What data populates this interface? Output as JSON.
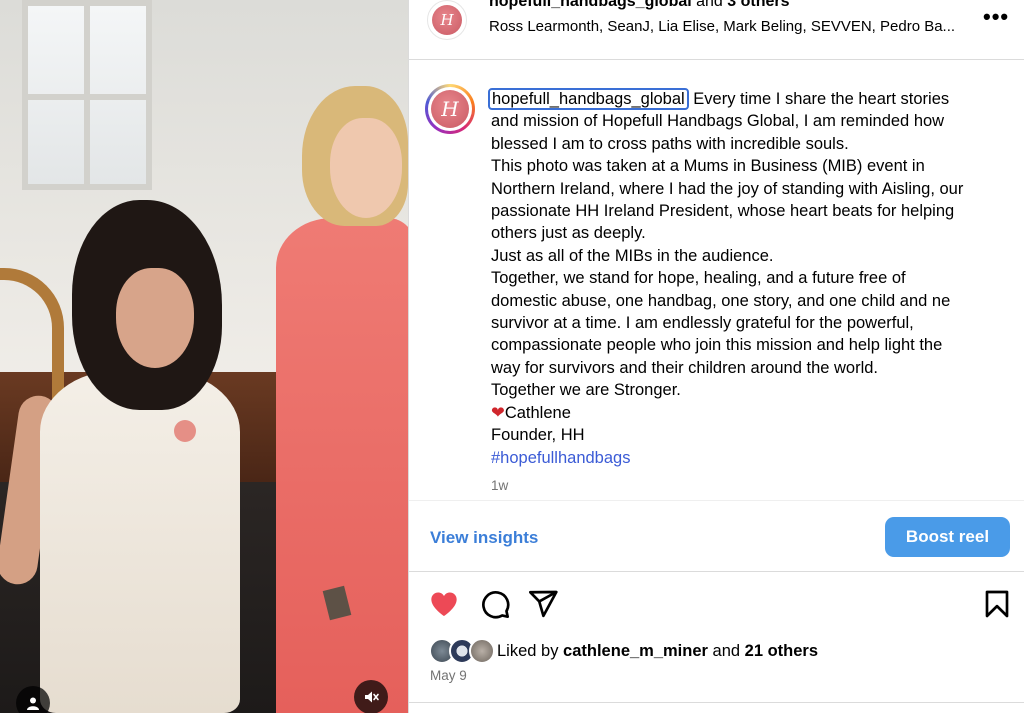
{
  "header": {
    "title_user": "hopefull_handbags_global",
    "title_and": " and ",
    "title_others": "3 others",
    "collaborators": "Ross Learmonth, SeanJ, Lia Elise, Mark Beling, SEVVEN, Pedro Ba...",
    "more_label": "•••"
  },
  "caption": {
    "username": "hopefull_handbags_global",
    "line1": " Every time I share the heart stories",
    "line2": "and mission of Hopefull Handbags Global, I am reminded how",
    "line3": "blessed I am to cross paths with incredible souls.",
    "line4": "This photo was taken at a Mums in Business (MIB) event in",
    "line5": "Northern Ireland, where I had the joy of standing with Aisling, our",
    "line6": "passionate HH Ireland President, whose heart beats for helping",
    "line7": "others just as deeply.",
    "line8": "Just as all of the MIBs in the audience.",
    "line9": "Together, we stand for hope, healing, and a future free of",
    "line10": "domestic abuse, one handbag, one story, and one child and ne",
    "line11": "survivor at a time. I am endlessly grateful for the powerful,",
    "line12": "compassionate people who join this mission and help light the",
    "line13": "way for survivors and their children around the world.",
    "line14": "Together we are Stronger.",
    "heart_emoji": "❤",
    "signature_name": "Cathlene",
    "signature_title": "Founder, HH",
    "hashtag": "#hopefullhandbags",
    "time_ago": "1w"
  },
  "insights": {
    "view_label": "View insights",
    "boost_label": "Boost reel"
  },
  "likes": {
    "prefix": "Liked by ",
    "top_liker": "cathlene_m_miner",
    "and": " and ",
    "others": "21 others",
    "date": "May 9"
  },
  "avatar_monogram": "H",
  "colors": {
    "link_blue": "#3b7ed8",
    "boost_button": "#4a9be8",
    "like_red": "#ed4956",
    "hashtag_blue": "#3b5bd6",
    "muted_gray": "#737373"
  },
  "icons": [
    "account-icon",
    "mute-icon",
    "more-icon",
    "heart-icon",
    "comment-icon",
    "share-icon",
    "save-icon"
  ]
}
